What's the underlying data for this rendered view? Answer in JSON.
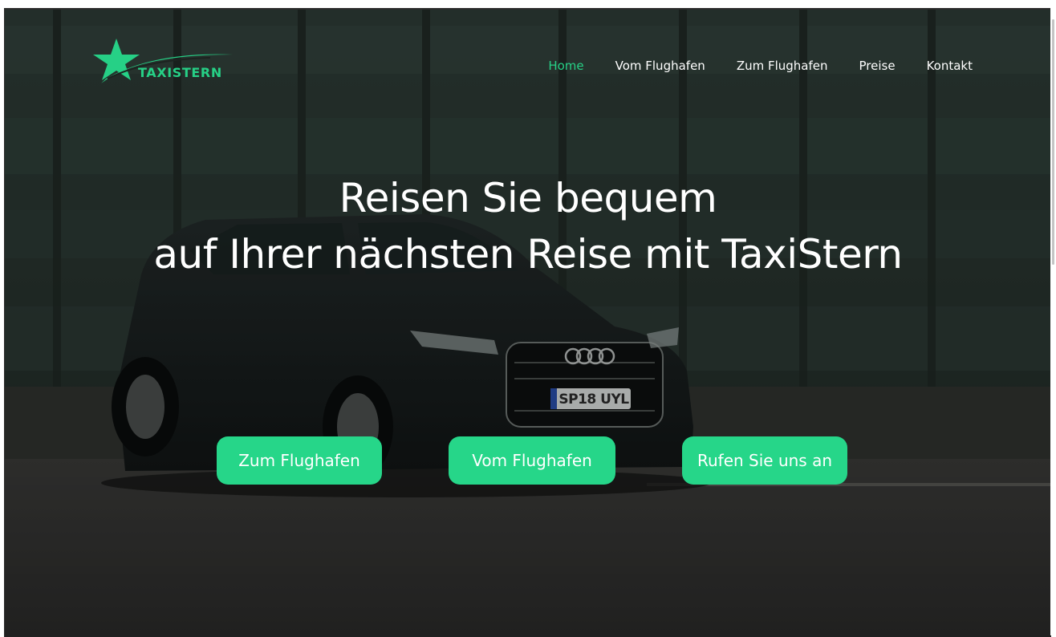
{
  "brand": {
    "name": "TAXISTERN",
    "accent_color": "#26d086",
    "logo_icon": "star-swoosh-icon"
  },
  "nav": {
    "items": [
      {
        "label": "Home",
        "active": true
      },
      {
        "label": "Vom Flughafen",
        "active": false
      },
      {
        "label": "Zum Flughafen",
        "active": false
      },
      {
        "label": "Preise",
        "active": false
      },
      {
        "label": "Kontakt",
        "active": false
      }
    ]
  },
  "hero": {
    "headline_line1": "Reisen Sie bequem",
    "headline_line2": "auf Ihrer nächsten Reise mit TaxiStern",
    "license_plate": "SP18 UYL",
    "buttons": {
      "to_airport": "Zum Flughafen",
      "from_airport": "Vom Flughafen",
      "call_us": "Rufen Sie uns an"
    },
    "button_color": "#26d689"
  }
}
